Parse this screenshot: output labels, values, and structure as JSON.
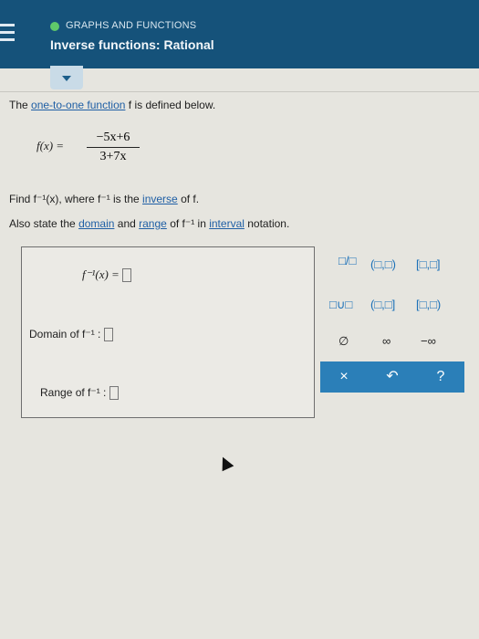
{
  "header": {
    "topic": "GRAPHS AND FUNCTIONS",
    "title": "Inverse functions: Rational"
  },
  "problem": {
    "intro_prefix": "The",
    "intro_link": "one-to-one function",
    "intro_suffix": "f is defined below.",
    "func_lhs": "f(x) =",
    "numerator": "−5x+6",
    "denominator": "3+7x",
    "find_prefix": "Find f⁻¹(x), where f⁻¹ is the",
    "find_link": "inverse",
    "find_suffix": "of f.",
    "also_prefix": "Also state the",
    "domain_link": "domain",
    "also_and": "and",
    "range_link": "range",
    "also_of": "of f⁻¹ in",
    "interval_link": "interval",
    "also_suffix": "notation."
  },
  "answer": {
    "finv_label": "f⁻¹(x) =",
    "domain_label": "Domain of f⁻¹ :",
    "range_label": "Range of f⁻¹ :"
  },
  "keypad": {
    "row1": [
      "□/□",
      "(□,□)",
      "[□,□]"
    ],
    "row2": [
      "□∪□",
      "(□,□]",
      "[□,□)"
    ],
    "row3": [
      "∅",
      "∞",
      "−∞"
    ],
    "actions": [
      "×",
      "↶",
      "?"
    ]
  }
}
